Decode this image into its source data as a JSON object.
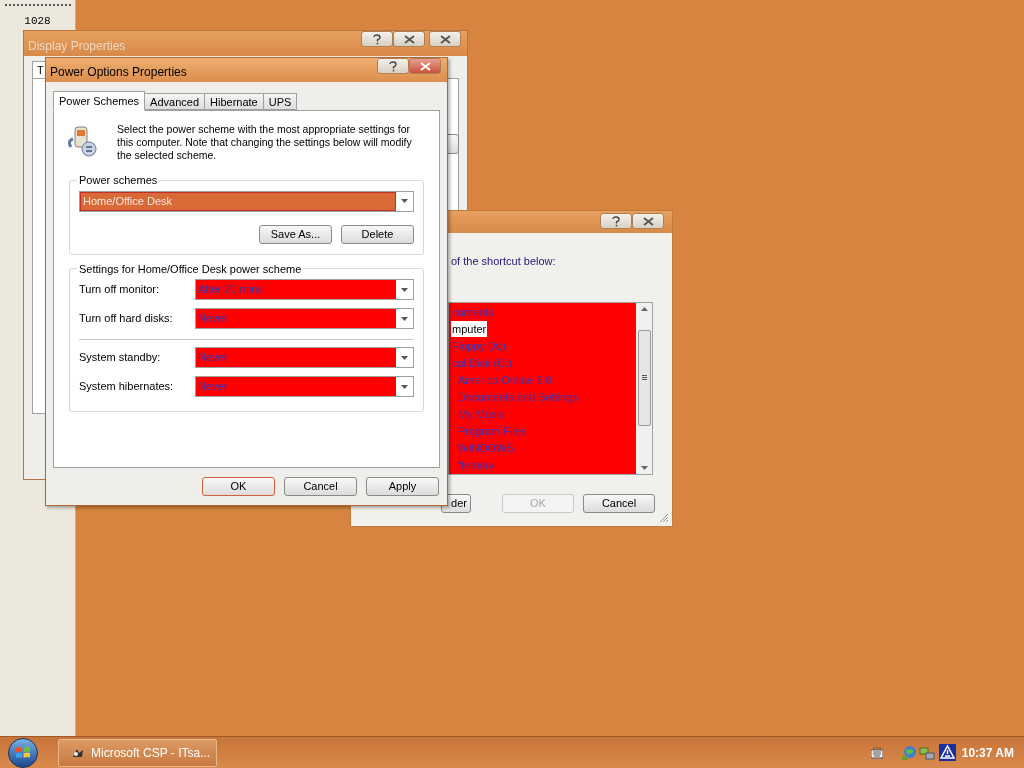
{
  "side_panel": {
    "label": "1028"
  },
  "display_properties": {
    "title": "Display Properties",
    "tabs": [
      {
        "label": "T",
        "selected": true
      }
    ]
  },
  "browse_dialog": {
    "instruction": "of the shortcut below:",
    "tree": [
      {
        "label": "cuments",
        "selected": false
      },
      {
        "label": "mputer",
        "selected": true,
        "children": [
          {
            "label": "Floppy (A:)",
            "selected": false
          },
          {
            "label": "cal Disk (C:)",
            "selected": false,
            "children": [
              {
                "label": "America Online 6.0",
                "selected": false
              },
              {
                "label": "Documents and Settings",
                "selected": false
              },
              {
                "label": "My Music",
                "selected": false
              },
              {
                "label": "Program Files",
                "selected": false
              },
              {
                "label": "WINDOWS",
                "selected": false
              },
              {
                "label": "ftemsrv",
                "selected": false
              }
            ]
          }
        ]
      }
    ],
    "buttons": [
      {
        "label": "der",
        "disabled": false
      },
      {
        "label": "OK",
        "disabled": true
      },
      {
        "label": "Cancel",
        "disabled": false
      }
    ]
  },
  "power_options": {
    "title": "Power Options Properties",
    "tabs": [
      {
        "label": "Power Schemes",
        "selected": true
      },
      {
        "label": "Advanced",
        "selected": false
      },
      {
        "label": "Hibernate",
        "selected": false
      },
      {
        "label": "UPS",
        "selected": false
      }
    ],
    "description": "Select the power scheme with the most appropriate settings for this computer. Note that changing the settings below will modify the selected scheme.",
    "schemes": {
      "legend": "Power schemes",
      "value": "Home/Office Desk",
      "buttons": [
        "Save As...",
        "Delete"
      ]
    },
    "settings": {
      "legend": "Settings for Home/Office Desk power scheme",
      "groups": [
        [
          {
            "label": "Turn off monitor:",
            "value": "After 20 mins"
          },
          {
            "label": "Turn off hard disks:",
            "value": "Never"
          }
        ],
        [
          {
            "label": "System standby:",
            "value": "Never"
          },
          {
            "label": "System hibernates:",
            "value": "Never"
          }
        ]
      ]
    },
    "buttons": [
      {
        "label": "OK",
        "default": true
      },
      {
        "label": "Cancel",
        "default": false
      },
      {
        "label": "Apply",
        "default": false
      }
    ]
  },
  "taskbar": {
    "tasks": [
      {
        "label": "Microsoft CSP - ITsa...",
        "selected": false
      }
    ],
    "clock": "10:37 AM"
  }
}
